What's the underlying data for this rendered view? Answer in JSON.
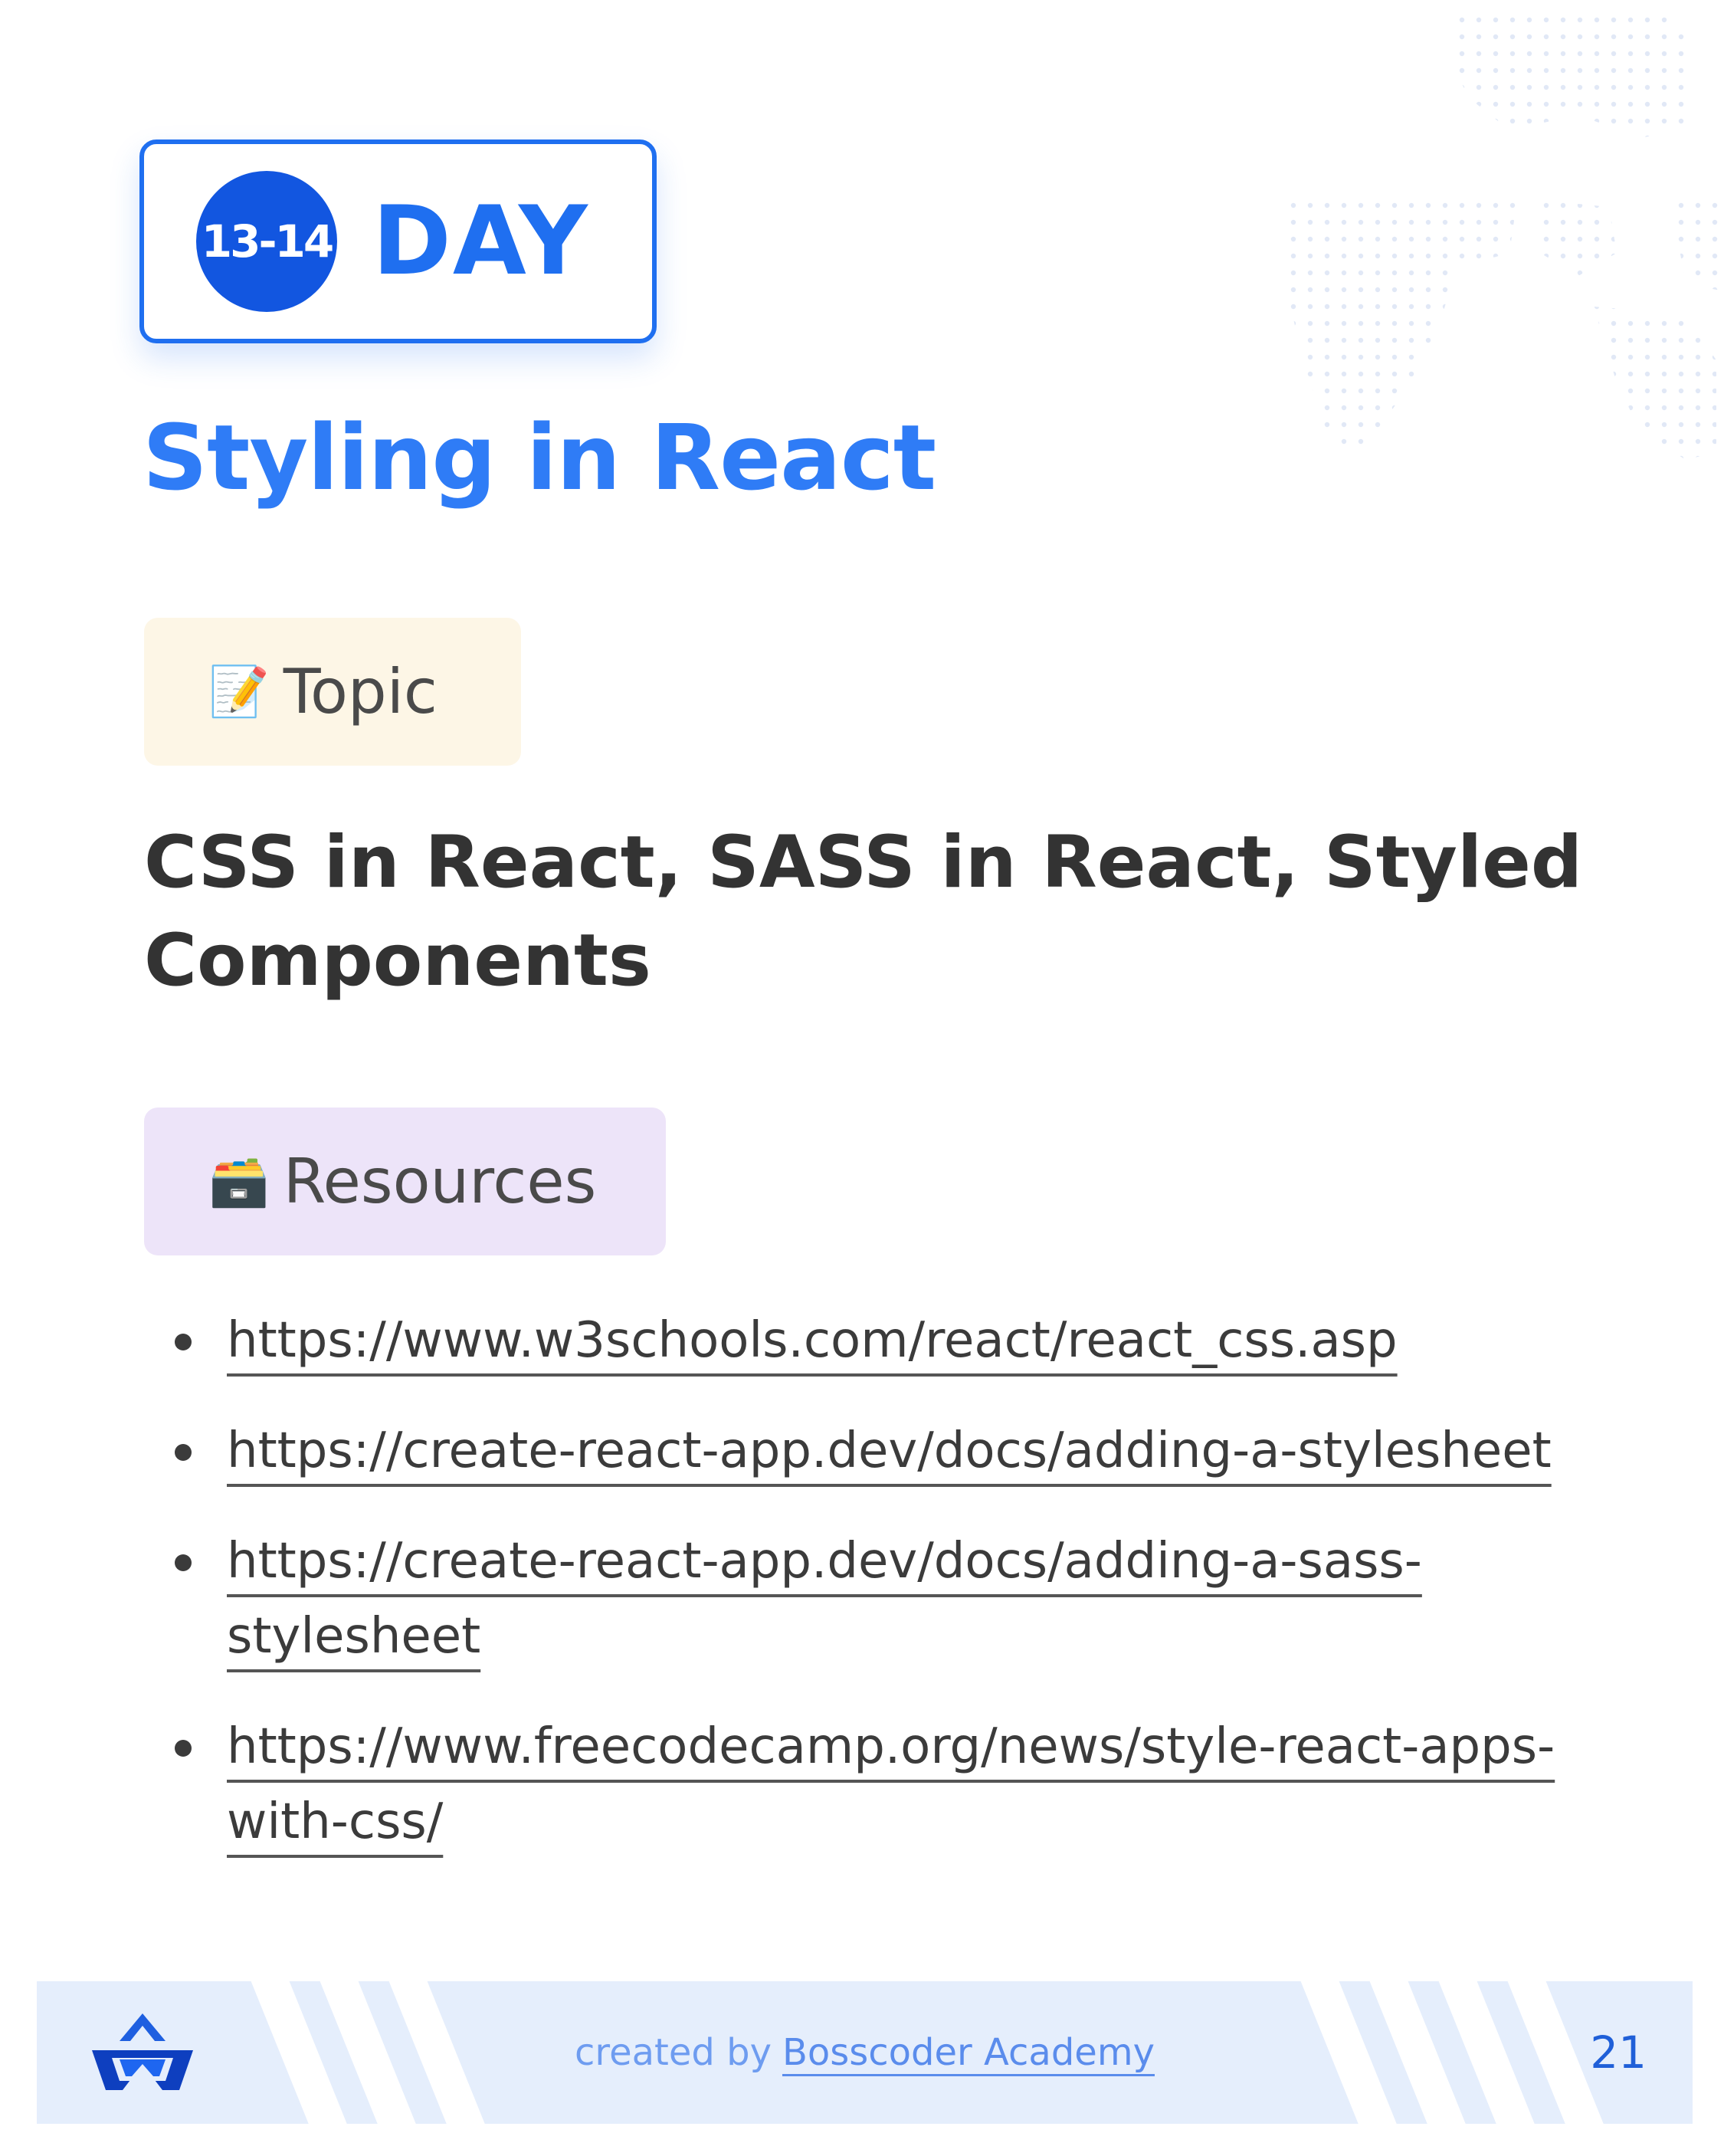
{
  "badge": {
    "number": "13-14",
    "word": "DAY"
  },
  "title": "Styling in React",
  "topic": {
    "icon": "memo-icon",
    "icon_glyph": "📝",
    "label": "Topic"
  },
  "topic_text": "CSS in React, SASS in React, Styled Components",
  "resources": {
    "icon": "file-cabinet-icon",
    "icon_glyph": "🗃️",
    "label": "Resources",
    "links": [
      "https://www.w3schools.com/react/react_css.asp",
      "https://create-react-app.dev/docs/adding-a-stylesheet",
      "https://create-react-app.dev/docs/adding-a-sass-stylesheet",
      "https://www.freecodecamp.org/news/style-react-apps-with-css/"
    ]
  },
  "footer": {
    "created_by": "created by",
    "brand": "Bosscoder Academy",
    "page_number": "21",
    "logo_icon": "bosscoder-logo-icon"
  },
  "colors": {
    "accent": "#1f6ff0",
    "title": "#2f7cf6",
    "topic_pill": "#fdf6e6",
    "resources_pill": "#ede4f9",
    "footer_bg": "#e5eefc"
  }
}
